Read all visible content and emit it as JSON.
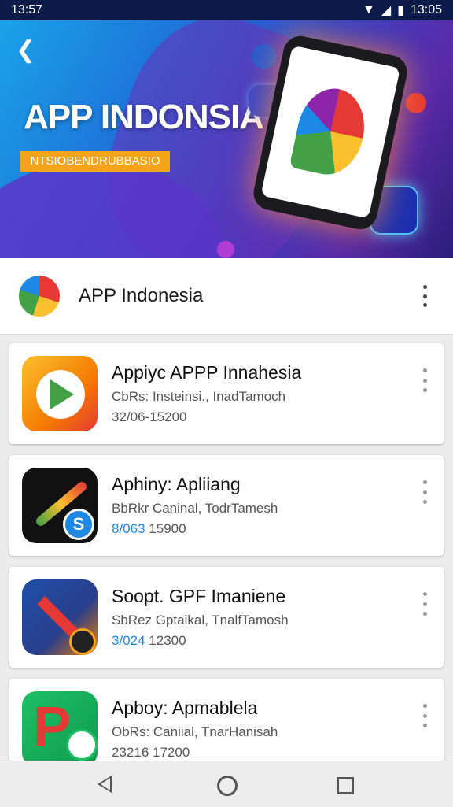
{
  "status": {
    "time": "13:57",
    "right_time": "13:05"
  },
  "hero": {
    "title": "APP INDONSIA",
    "tag": "NTSIOBENDRUBBASIO"
  },
  "header": {
    "title": "APP Indonesia"
  },
  "apps": [
    {
      "title": "Appiyc APPP Innahesia",
      "subtitle": "CbRs: Insteinsi., InadTamoch",
      "meta_accent": "",
      "meta": "32/06-15200"
    },
    {
      "title": "Aphiny: Apliiang",
      "subtitle": "BbRkr Caninal, TodrTamesh",
      "meta_accent": "8/063",
      "meta": "15900"
    },
    {
      "title": "Soopt. GPF Imaniene",
      "subtitle": "SbRez Gptaikal, TnalfTamosh",
      "meta_accent": "3/024",
      "meta": "12300"
    },
    {
      "title": "Apboy: Apmablela",
      "subtitle": "ObRs: Caniial, TnarHanisah",
      "meta_accent": "",
      "meta": "23216 17200"
    }
  ],
  "colors": {
    "accent": "#1e88e5",
    "tag": "#f4a41a",
    "status_bar": "#0d1b4a"
  }
}
